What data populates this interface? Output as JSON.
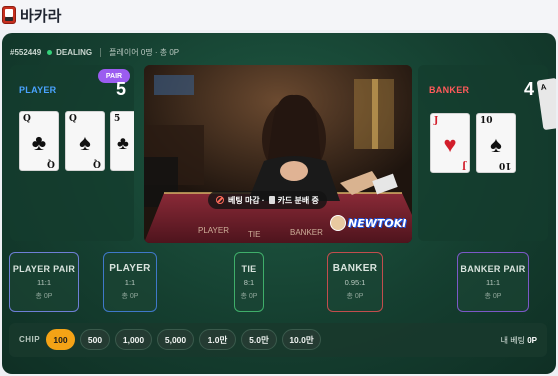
{
  "app": {
    "title": "바카라",
    "icon": "baccarat-card-icon"
  },
  "status": {
    "table_id": "#552449",
    "state": "DEALING",
    "state_color": "#34d27a",
    "players_text": "플레이어 0명 · 총 0P"
  },
  "player": {
    "label": "PLAYER",
    "score": "5",
    "pair_badge": "PAIR",
    "cards": [
      {
        "rank": "Q",
        "suit": "♣",
        "color": "black"
      },
      {
        "rank": "Q",
        "suit": "♠",
        "color": "black"
      },
      {
        "rank": "5",
        "suit": "♣",
        "color": "black"
      }
    ]
  },
  "banker": {
    "label": "BANKER",
    "score": "4",
    "cards": [
      {
        "rank": "J",
        "suit": "♥",
        "color": "red"
      },
      {
        "rank": "10",
        "suit": "♠",
        "color": "black"
      }
    ],
    "edge_card_rank": "A"
  },
  "video": {
    "caption_left": "베팅 마감 ·",
    "caption_right": "카드 분배 중",
    "watermark": "NEWTOKI"
  },
  "bets": {
    "player_pair": {
      "title": "PLAYER PAIR",
      "odds": "11:1",
      "total": "총 0P"
    },
    "player": {
      "title": "PLAYER",
      "odds": "1:1",
      "total": "총 0P"
    },
    "tie": {
      "title": "TIE",
      "odds": "8:1",
      "total": "총 0P"
    },
    "banker": {
      "title": "BANKER",
      "odds": "0.95:1",
      "total": "총 0P"
    },
    "banker_pair": {
      "title": "BANKER PAIR",
      "odds": "11:1",
      "total": "총 0P"
    }
  },
  "chips": {
    "label": "CHIP",
    "values": [
      "100",
      "500",
      "1,000",
      "5,000",
      "1.0만",
      "5.0만",
      "10.0만"
    ],
    "selected": "100",
    "my_bet_label": "내 베팅",
    "my_bet_value": "0P"
  },
  "colors": {
    "player": "#4aa3ff",
    "banker": "#ff5a5a",
    "pair_badge": "#9b5cf0",
    "chip_selected": "#f4a316"
  }
}
